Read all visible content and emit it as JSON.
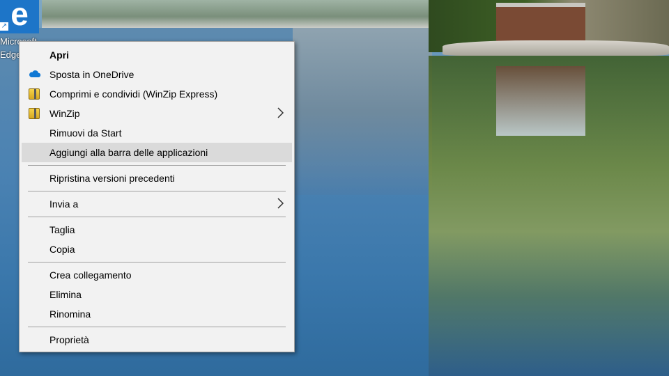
{
  "desktop": {
    "icon_label": "Microsoft\nEdge"
  },
  "menu": {
    "items": [
      {
        "label": "Apri",
        "icon": "none"
      },
      {
        "label": "Sposta in OneDrive",
        "icon": "onedrive-cloud-icon"
      },
      {
        "label": "Comprimi e condividi (WinZip Express)",
        "icon": "winzip-icon"
      },
      {
        "label": "WinZip",
        "icon": "winzip-icon",
        "submenu": true
      },
      {
        "label": "Rimuovi da Start",
        "icon": "none"
      },
      {
        "label": "Aggiungi alla barra delle applicazioni",
        "icon": "none",
        "highlighted": true
      },
      {
        "label": "Ripristina versioni precedenti",
        "icon": "none"
      },
      {
        "label": "Invia a",
        "icon": "none",
        "submenu": true
      },
      {
        "label": "Taglia",
        "icon": "none"
      },
      {
        "label": "Copia",
        "icon": "none"
      },
      {
        "label": "Crea collegamento",
        "icon": "none"
      },
      {
        "label": "Elimina",
        "icon": "none"
      },
      {
        "label": "Rinomina",
        "icon": "none"
      },
      {
        "label": "Proprietà",
        "icon": "none"
      }
    ]
  },
  "colors": {
    "menu_background": "#f2f2f2",
    "highlight": "#dadada",
    "onedrive": "#0f78d4",
    "edge_tile": "#1d75c8"
  }
}
